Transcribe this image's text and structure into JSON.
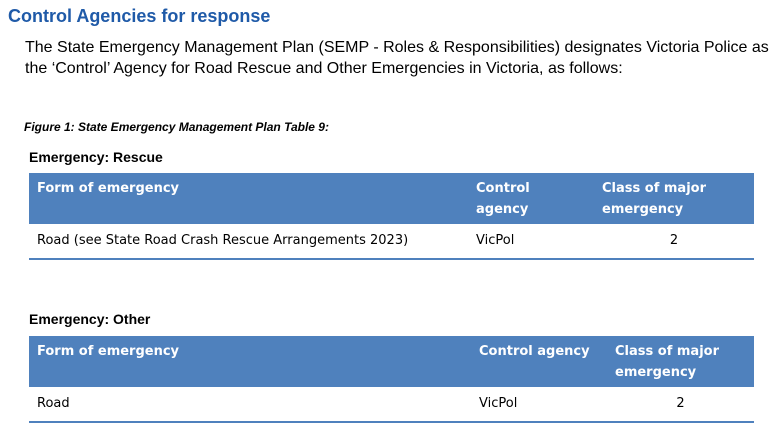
{
  "heading": "Control Agencies for response",
  "intro": "The State Emergency Management Plan (SEMP - Roles & Responsibilities) designates Victoria Police as the ‘Control’ Agency for Road Rescue and Other Emergencies in Victoria, as follows:",
  "figure_caption": "Figure 1: State Emergency Management Plan Table 9:",
  "tables": [
    {
      "title": "Emergency: Rescue",
      "headers": [
        "Form of emergency",
        "Control agency",
        "Class of major emergency"
      ],
      "rows": [
        [
          "Road (see State Road Crash Rescue Arrangements 2023)",
          "VicPol",
          "2"
        ]
      ]
    },
    {
      "title": "Emergency: Other",
      "headers": [
        "Form of emergency",
        "Control agency",
        "Class of major emergency"
      ],
      "rows": [
        [
          "Road",
          "VicPol",
          "2"
        ]
      ]
    }
  ],
  "colors": {
    "heading": "#1f5aa8",
    "table_header": "#4f81bd",
    "table_header_text": "#ffffff",
    "row_border": "#4f81bd"
  }
}
